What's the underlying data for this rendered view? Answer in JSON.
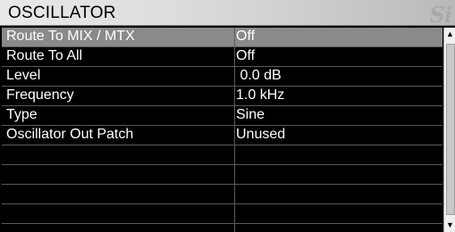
{
  "window": {
    "title": "OSCILLATOR",
    "logo_text": "Si"
  },
  "rows": [
    {
      "label": "Route To MIX / MTX",
      "value": "Off",
      "selected": true
    },
    {
      "label": "Route To All",
      "value": "Off",
      "selected": false
    },
    {
      "label": "Level",
      "value": " 0.0 dB",
      "selected": false
    },
    {
      "label": "Frequency",
      "value": "1.0 kHz",
      "selected": false
    },
    {
      "label": "Type",
      "value": "Sine",
      "selected": false
    },
    {
      "label": "Oscillator Out Patch",
      "value": "Unused",
      "selected": false
    },
    {
      "label": "",
      "value": "",
      "selected": false
    },
    {
      "label": "",
      "value": "",
      "selected": false
    },
    {
      "label": "",
      "value": "",
      "selected": false
    },
    {
      "label": "",
      "value": "",
      "selected": false
    }
  ],
  "scrollbar": {
    "up_icon": "arrow-up-icon",
    "down_icon": "arrow-down-icon"
  }
}
